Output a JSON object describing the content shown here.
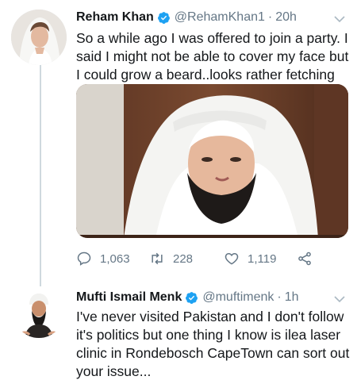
{
  "tweets": [
    {
      "author": "Reham Khan",
      "handle": "@RehamKhan1",
      "separator": "·",
      "time": "20h",
      "text": "So a while ago I was offered to join a party. I said I might not be able to cover my face but I could grow a beard..looks rather fetching on me.",
      "stats": {
        "replies": "1,063",
        "retweets": "228",
        "likes": "1,119"
      }
    },
    {
      "author": "Mufti Ismail Menk",
      "handle": "@muftimenk",
      "separator": "·",
      "time": "1h",
      "text": "I've never visited Pakistan and I don't follow it's politics but one thing I know is ilea laser clinic in Rondebosch CapeTown can sort out your issue..."
    }
  ],
  "icons": {
    "verified": "verified-badge-icon",
    "menu": "chevron-down-icon",
    "reply": "reply-icon",
    "retweet": "retweet-icon",
    "like": "heart-icon",
    "share": "share-icon"
  },
  "colors": {
    "accent": "#1da1f2",
    "text": "#14171a",
    "muted": "#657786",
    "thread_line": "#cfd9de"
  }
}
